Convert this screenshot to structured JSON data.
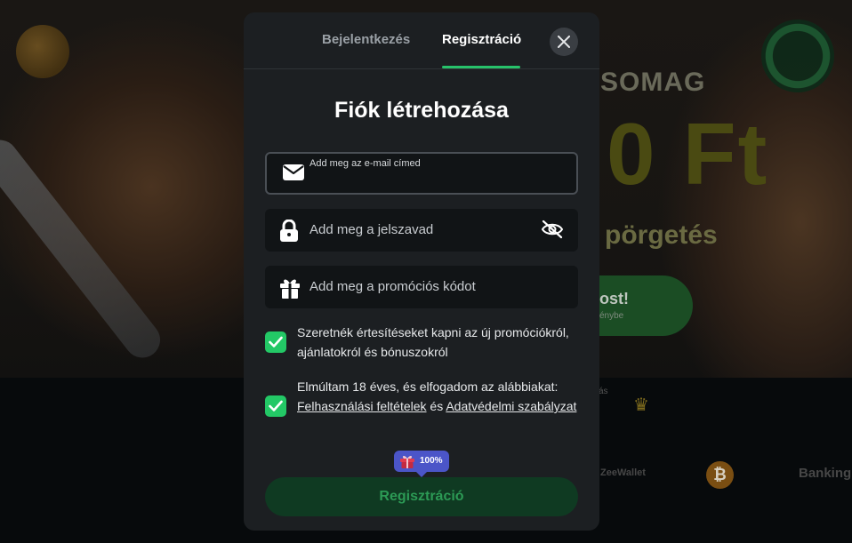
{
  "background": {
    "promo_title": "SOMAG",
    "promo_amount": "0 Ft",
    "promo_spins": "pörgetés",
    "cta_main": "ost!",
    "cta_sub": "énybe",
    "strip_text": "ás",
    "payment_logo_1": "ZeeWallet",
    "payment_logo_2": "Banking"
  },
  "modal": {
    "tabs": [
      {
        "label": "Bejelentkezés",
        "active": false
      },
      {
        "label": "Regisztráció",
        "active": true
      }
    ],
    "close_icon": "close-icon",
    "heading": "Fiók létrehozása",
    "fields": {
      "email": {
        "label": "Add meg az e-mail címed",
        "value": "",
        "icon": "envelope-icon"
      },
      "password": {
        "placeholder": "Add meg a jelszavad",
        "icon": "lock-icon",
        "toggle_icon": "eye-off-icon"
      },
      "promo": {
        "placeholder": "Add meg a promóciós kódot",
        "icon": "gift-icon"
      }
    },
    "checkboxes": {
      "notifications": {
        "checked": true,
        "text": "Szeretnék értesítéseket kapni az új promóciókról, ajánlatokról és bónuszokról"
      },
      "terms": {
        "checked": true,
        "text_before": "Elmúltam 18 éves, és elfogadom az alábbiakat: ",
        "terms_link": "Felhasználási feltételek",
        "and": " és ",
        "privacy_link": "Adatvédelmi szabályzat"
      }
    },
    "progress_badge": {
      "value": "100%",
      "icon": "gift-icon"
    },
    "submit_label": "Regisztráció"
  },
  "colors": {
    "accent": "#27c26a",
    "checkbox": "#23c866",
    "modal_bg": "#1c1f22",
    "input_bg": "#111416",
    "badge": "#4b55c8",
    "submit_bg": "#0f3a22"
  }
}
